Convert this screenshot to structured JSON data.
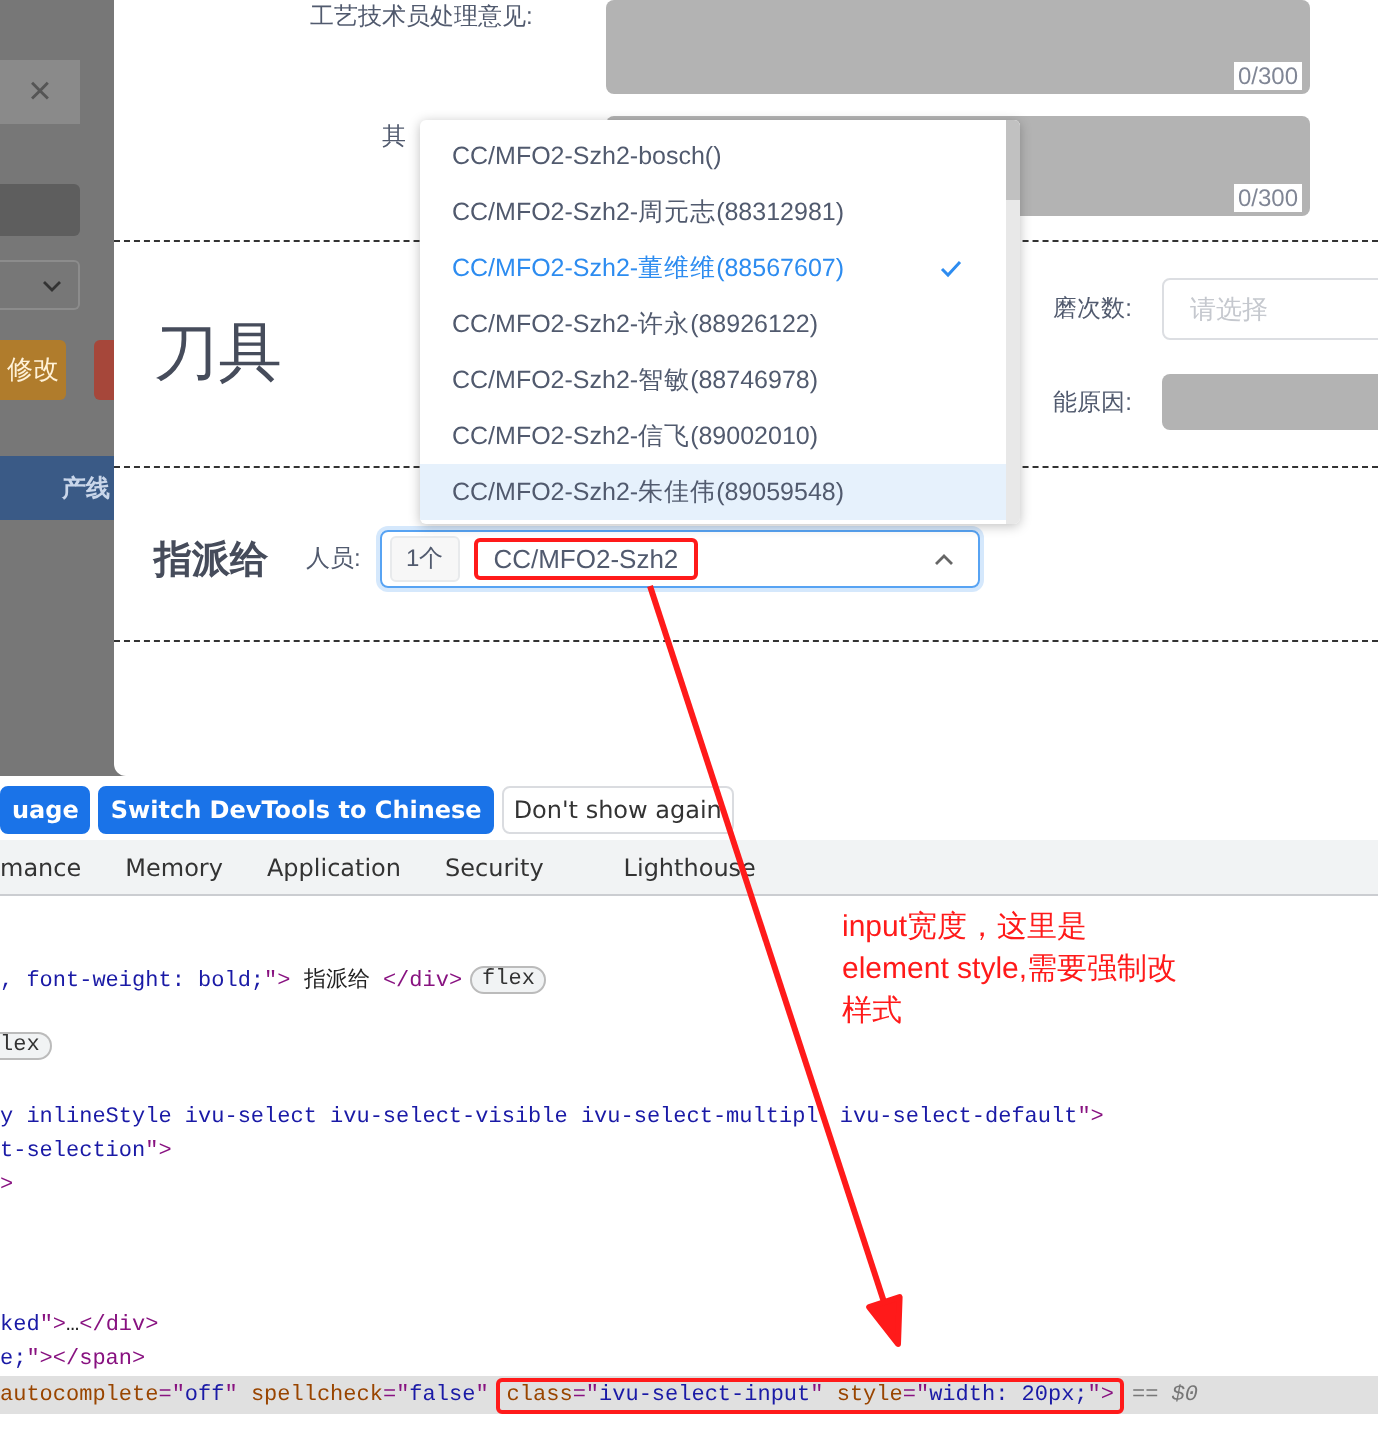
{
  "background_page": {
    "close_glyph": "×",
    "edit_button": "修改",
    "tab_bar_label": "产线"
  },
  "modal": {
    "remarks": [
      {
        "label": "工艺技术员处理意见:",
        "counter": "0/300"
      },
      {
        "label": "其",
        "counter": "0/300"
      }
    ],
    "tool_section": {
      "title": "刀具",
      "fields": [
        {
          "label": "磨次数:",
          "placeholder": "请选择",
          "kind": "select"
        },
        {
          "label": "能原因:",
          "kind": "input"
        }
      ]
    },
    "assign_section": {
      "title": "指派给",
      "label": "人员:",
      "tag": "1个",
      "value": "CC/MFO2-Szh2",
      "value_annotated": true,
      "expanded": true
    },
    "dropdown": [
      {
        "label": "CC/MFO2-Szh2-bosch()",
        "selected": false,
        "highlighted": false
      },
      {
        "label": "CC/MFO2-Szh2-周元志(88312981)",
        "selected": false,
        "highlighted": false
      },
      {
        "label": "CC/MFO2-Szh2-董维维(88567607)",
        "selected": true,
        "highlighted": false
      },
      {
        "label": "CC/MFO2-Szh2-许永(88926122)",
        "selected": false,
        "highlighted": false
      },
      {
        "label": "CC/MFO2-Szh2-智敏(88746978)",
        "selected": false,
        "highlighted": false
      },
      {
        "label": "CC/MFO2-Szh2-信飞(89002010)",
        "selected": false,
        "highlighted": false
      },
      {
        "label": "CC/MFO2-Szh2-朱佳伟(89059548)",
        "selected": false,
        "highlighted": true
      }
    ]
  },
  "devtools": {
    "language_bar": [
      {
        "label": "uage",
        "kind": "primary"
      },
      {
        "label": "Switch DevTools to Chinese",
        "kind": "primary"
      },
      {
        "label": "Don't show again",
        "kind": "secondary"
      }
    ],
    "tabs": [
      {
        "label": "mance",
        "selected": false
      },
      {
        "label": "Memory",
        "selected": false
      },
      {
        "label": "Application",
        "selected": false
      },
      {
        "label": "Security",
        "selected": false
      },
      {
        "label": "Lighthouse",
        "selected": false
      }
    ],
    "code_lines": [
      {
        "selected": false,
        "segments": [
          {
            "kind": "code",
            "parts": [
              {
                "kind": "value",
                "text": ", font-weight: bold;"
              },
              {
                "kind": "tag",
                "text": "\">"
              },
              {
                "kind": "text",
                "text": " 指派给 "
              },
              {
                "kind": "tag",
                "text": "</div>"
              }
            ]
          },
          {
            "kind": "badge",
            "text": "flex"
          }
        ]
      },
      {
        "selected": false,
        "segments": [
          {
            "kind": "badge",
            "text": "lex"
          }
        ]
      },
      {
        "selected": false,
        "segments": [
          {
            "kind": "code",
            "parts": [
              {
                "kind": "value",
                "text": "y inlineStyle ivu-select ivu-select-visible ivu-select-multipl"
              }
            ]
          },
          {
            "kind": "code",
            "parts": [
              {
                "kind": "value",
                "text": " ivu-select-default"
              },
              {
                "kind": "tag",
                "text": "\">"
              }
            ]
          }
        ]
      },
      {
        "selected": false,
        "segments": [
          {
            "kind": "code",
            "parts": [
              {
                "kind": "value",
                "text": "t-selection"
              },
              {
                "kind": "tag",
                "text": "\">"
              }
            ]
          }
        ]
      },
      {
        "selected": false,
        "segments": [
          {
            "kind": "code",
            "parts": [
              {
                "kind": "tag",
                "text": ">"
              }
            ]
          }
        ]
      },
      {
        "selected": false,
        "segments": [
          {
            "kind": "code",
            "parts": [
              {
                "kind": "value",
                "text": "ked"
              },
              {
                "kind": "tag",
                "text": "\">"
              },
              {
                "kind": "text",
                "text": "…"
              },
              {
                "kind": "tag",
                "text": "</div>"
              }
            ]
          }
        ]
      },
      {
        "selected": false,
        "segments": [
          {
            "kind": "code",
            "parts": [
              {
                "kind": "value",
                "text": "e;"
              },
              {
                "kind": "tag",
                "text": "\">"
              },
              {
                "kind": "tag",
                "text": "</span>"
              }
            ]
          }
        ]
      },
      {
        "selected": true,
        "segments": [
          {
            "kind": "code",
            "parts": [
              {
                "kind": "attr",
                "text": "autocomplete"
              },
              {
                "kind": "tag",
                "text": "=\""
              },
              {
                "kind": "value",
                "text": "off"
              },
              {
                "kind": "tag",
                "text": "\""
              },
              {
                "kind": "attr",
                "text": " spellcheck"
              },
              {
                "kind": "tag",
                "text": "=\""
              },
              {
                "kind": "value",
                "text": "false"
              },
              {
                "kind": "tag",
                "text": "\""
              }
            ]
          },
          {
            "kind": "annotated",
            "parts": [
              {
                "kind": "attr",
                "text": "class"
              },
              {
                "kind": "tag",
                "text": "=\""
              },
              {
                "kind": "value",
                "text": "ivu-select-input"
              },
              {
                "kind": "tag",
                "text": "\""
              },
              {
                "kind": "attr",
                "text": " style"
              },
              {
                "kind": "tag",
                "text": "=\""
              },
              {
                "kind": "value",
                "text": "width: 20px;"
              },
              {
                "kind": "tag",
                "text": "\">"
              }
            ]
          },
          {
            "kind": "marker",
            "text": "== $0"
          }
        ]
      }
    ]
  },
  "annotation": {
    "note_lines": [
      "input宽度，这里是",
      "element style,需要强制改",
      "样式"
    ]
  }
}
